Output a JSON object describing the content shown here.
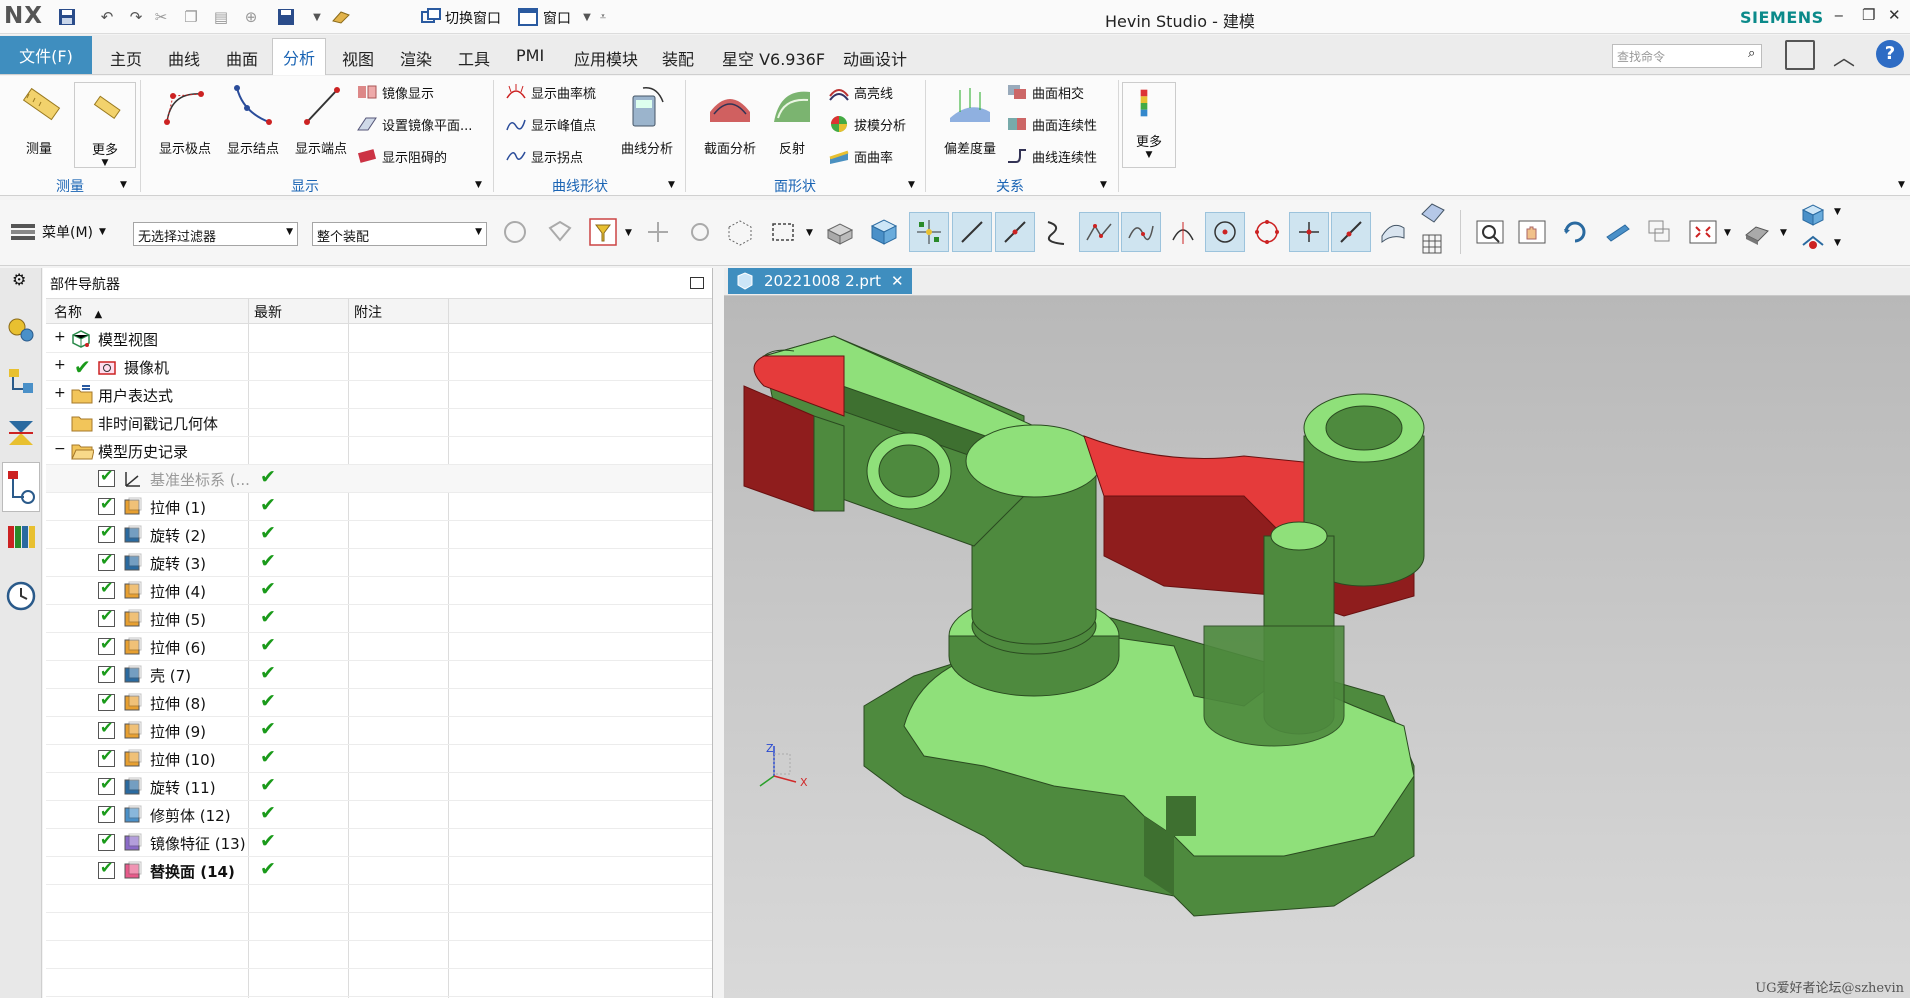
{
  "titlebar": {
    "logo": "NX",
    "switch_window": "切换窗口",
    "window_menu": "窗口",
    "app_title": "Hevin Studio - 建模",
    "brand": "SIEMENS"
  },
  "menu": {
    "file": "文件(F)",
    "tabs": [
      "主页",
      "曲线",
      "曲面",
      "分析",
      "视图",
      "渲染",
      "工具",
      "PMI",
      "应用模块",
      "装配",
      "星空 V6.936F",
      "动画设计"
    ],
    "search_placeholder": "查找命令"
  },
  "ribbon": {
    "measure": {
      "measure": "测量",
      "more": "更多",
      "group": "测量"
    },
    "display": {
      "poles": "显示极点",
      "knots": "显示结点",
      "endpoints": "显示端点",
      "mirror": "镜像显示",
      "set_mirror_plane": "设置镜像平面...",
      "show_blocking": "显示阻碍的",
      "group": "显示"
    },
    "curve_shape": {
      "curvature_comb": "显示曲率梳",
      "peak_points": "显示峰值点",
      "inflections": "显示拐点",
      "curve_analysis": "曲线分析",
      "group": "曲线形状"
    },
    "face_shape": {
      "section_analysis": "截面分析",
      "reflection": "反射",
      "highlight_lines": "高亮线",
      "draft_analysis": "拔模分析",
      "face_curvature": "面曲率",
      "group": "面形状"
    },
    "relation": {
      "deviation": "偏差度量",
      "face_intersection": "曲面相交",
      "face_continuity": "曲面连续性",
      "curve_continuity": "曲线连续性",
      "group": "关系"
    },
    "more": "更多"
  },
  "toolbar": {
    "menu": "菜单(M)",
    "filter": "无选择过滤器",
    "scope": "整个装配"
  },
  "navigator": {
    "title": "部件导航器",
    "columns": {
      "name": "名称",
      "latest": "最新",
      "comment": "附注"
    },
    "nodes": [
      {
        "label": "模型视图",
        "expander": "+",
        "level": 0
      },
      {
        "label": "摄像机",
        "expander": "+",
        "level": 0
      },
      {
        "label": "用户表达式",
        "expander": "+",
        "level": 0
      },
      {
        "label": "非时间戳记几何体",
        "expander": "",
        "level": 0
      },
      {
        "label": "模型历史记录",
        "expander": "−",
        "level": 0
      }
    ],
    "features": [
      {
        "label": "基准坐标系 (...",
        "latest": "✔",
        "dim": true
      },
      {
        "label": "拉伸 (1)",
        "latest": "✔"
      },
      {
        "label": "旋转 (2)",
        "latest": "✔"
      },
      {
        "label": "旋转 (3)",
        "latest": "✔"
      },
      {
        "label": "拉伸 (4)",
        "latest": "✔"
      },
      {
        "label": "拉伸 (5)",
        "latest": "✔"
      },
      {
        "label": "拉伸 (6)",
        "latest": "✔"
      },
      {
        "label": "壳 (7)",
        "latest": "✔"
      },
      {
        "label": "拉伸 (8)",
        "latest": "✔"
      },
      {
        "label": "拉伸 (9)",
        "latest": "✔"
      },
      {
        "label": "拉伸 (10)",
        "latest": "✔"
      },
      {
        "label": "旋转 (11)",
        "latest": "✔"
      },
      {
        "label": "修剪体 (12)",
        "latest": "✔"
      },
      {
        "label": "镜像特征 (13)",
        "latest": "✔"
      },
      {
        "label": "替换面 (14)",
        "latest": "✔",
        "bold": true
      }
    ]
  },
  "viewport": {
    "doc_tab": "20221008 2.prt",
    "triad": {
      "z": "Z",
      "x": "X"
    },
    "watermark": "UG爱好者论坛@szhevin",
    "colors": {
      "green": "#4e8a3e",
      "light_green": "#8fe07a",
      "red": "#e53b3b",
      "dark_red": "#8f1d1d"
    }
  }
}
